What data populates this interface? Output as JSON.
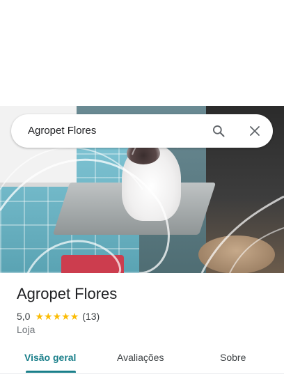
{
  "search": {
    "query": "Agropet Flores"
  },
  "icons": {
    "search": "search-icon",
    "close": "close-icon"
  },
  "place": {
    "name": "Agropet Flores",
    "rating": "5,0",
    "stars": 5,
    "review_count": "(13)",
    "category": "Loja"
  },
  "tabs": [
    {
      "label": "Visão geral",
      "active": true
    },
    {
      "label": "Avaliações",
      "active": false
    },
    {
      "label": "Sobre",
      "active": false
    }
  ],
  "colors": {
    "accent": "#1a7f8a",
    "star": "#fbbc04",
    "title": "#202124"
  }
}
